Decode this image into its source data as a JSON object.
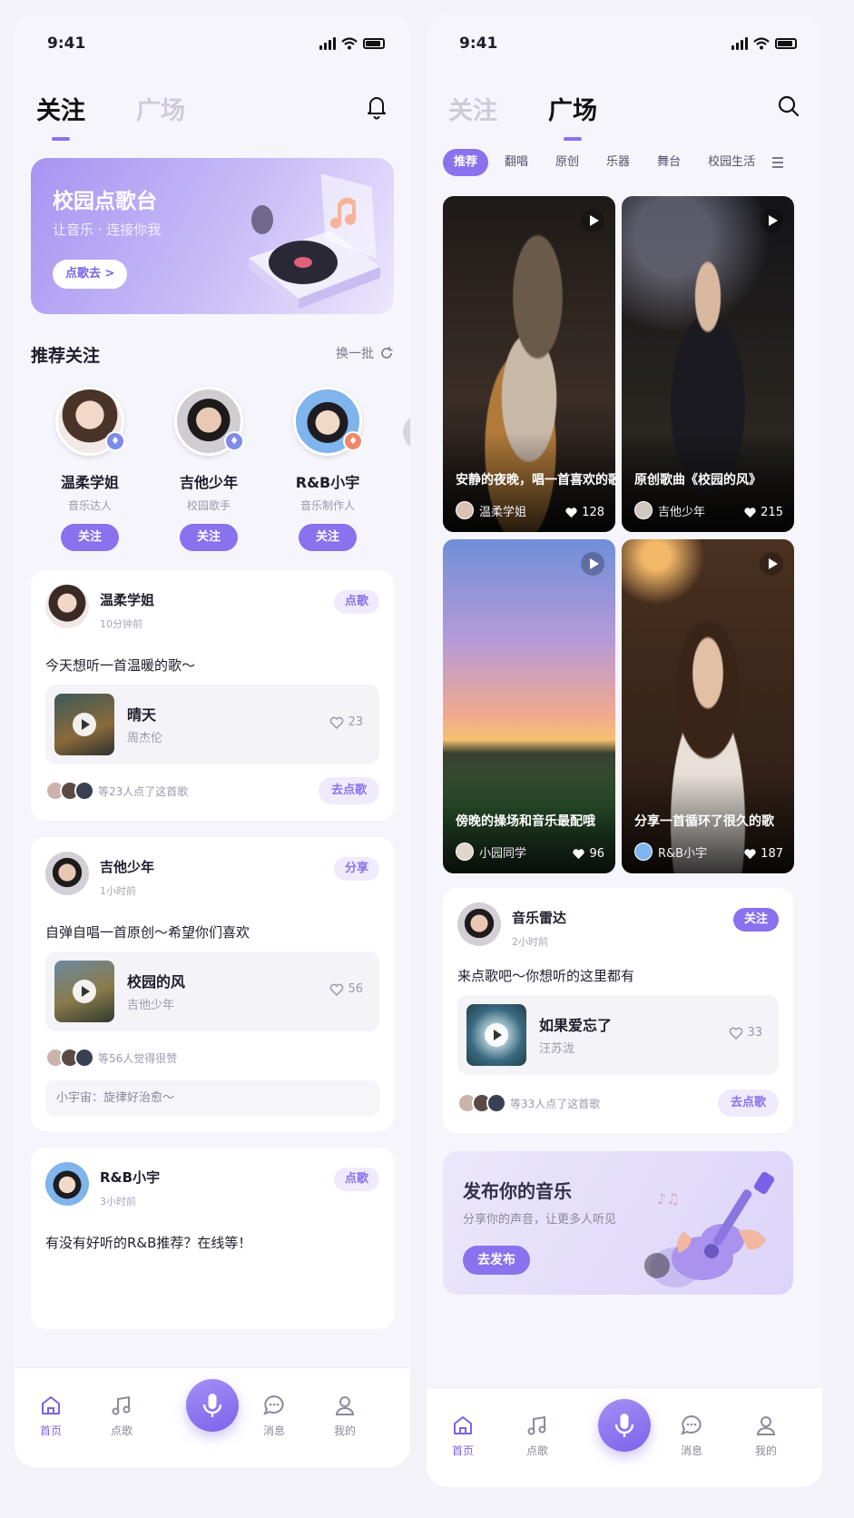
{
  "colors": {
    "accent": "#8a71ee",
    "accent_light": "#efebfd"
  },
  "left": {
    "status": {
      "time": "9:41"
    },
    "tabs": [
      "关注",
      "广场"
    ],
    "active_tab": "关注",
    "banner": {
      "title": "校园点歌台",
      "subtitle": "让音乐 · 连接你我",
      "button": "点歌去 >"
    },
    "recommend": {
      "title": "推荐关注",
      "refresh": "换一批",
      "users": [
        {
          "name": "温柔学姐",
          "role": "音乐达人",
          "button": "关注"
        },
        {
          "name": "吉他少年",
          "role": "校园歌手",
          "button": "关注"
        },
        {
          "name": "R&B小宇",
          "role": "音乐制作人",
          "button": "关注"
        }
      ]
    },
    "posts": [
      {
        "name": "温柔学姐",
        "time": "10分钟前",
        "tag": "点歌",
        "text": "今天想听一首温暖的歌～",
        "song": "晴天",
        "artist": "周杰伦",
        "likes": "23",
        "footer": "等23人点了这首歌",
        "action": "去点歌"
      },
      {
        "name": "吉他少年",
        "time": "1小时前",
        "tag": "分享",
        "text": "自弹自唱一首原创～希望你们喜欢",
        "song": "校园的风",
        "artist": "吉他少年",
        "likes": "56",
        "footer": "等56人觉得很赞",
        "comment": "小宇宙：旋律好治愈～"
      },
      {
        "name": "R&B小宇",
        "time": "3小时前",
        "tag": "点歌",
        "text": "有没有好听的R&B推荐？在线等！"
      }
    ],
    "nav": [
      "首页",
      "点歌",
      "消息",
      "我的"
    ]
  },
  "right": {
    "status": {
      "time": "9:41"
    },
    "tabs": [
      "关注",
      "广场"
    ],
    "active_tab": "广场",
    "chips": [
      "推荐",
      "翻唱",
      "原创",
      "乐器",
      "舞台",
      "校园生活"
    ],
    "videos": [
      {
        "title": "安静的夜晚，唱一首喜欢的歌",
        "user": "温柔学姐",
        "likes": "128"
      },
      {
        "title": "原创歌曲《校园的风》",
        "user": "吉他少年",
        "likes": "215"
      },
      {
        "title": "傍晚的操场和音乐最配哦",
        "user": "小园同学",
        "likes": "96"
      },
      {
        "title": "分享一首循环了很久的歌",
        "user": "R&B小宇",
        "likes": "187"
      }
    ],
    "post": {
      "name": "音乐雷达",
      "time": "2小时前",
      "tag": "关注",
      "text": "来点歌吧～你想听的这里都有",
      "song": "如果爱忘了",
      "artist": "汪苏泷",
      "likes": "33",
      "footer": "等33人点了这首歌",
      "action": "去点歌"
    },
    "publish": {
      "title": "发布你的音乐",
      "subtitle": "分享你的声音，让更多人听见",
      "button": "去发布"
    },
    "nav": [
      "首页",
      "点歌",
      "消息",
      "我的"
    ]
  }
}
